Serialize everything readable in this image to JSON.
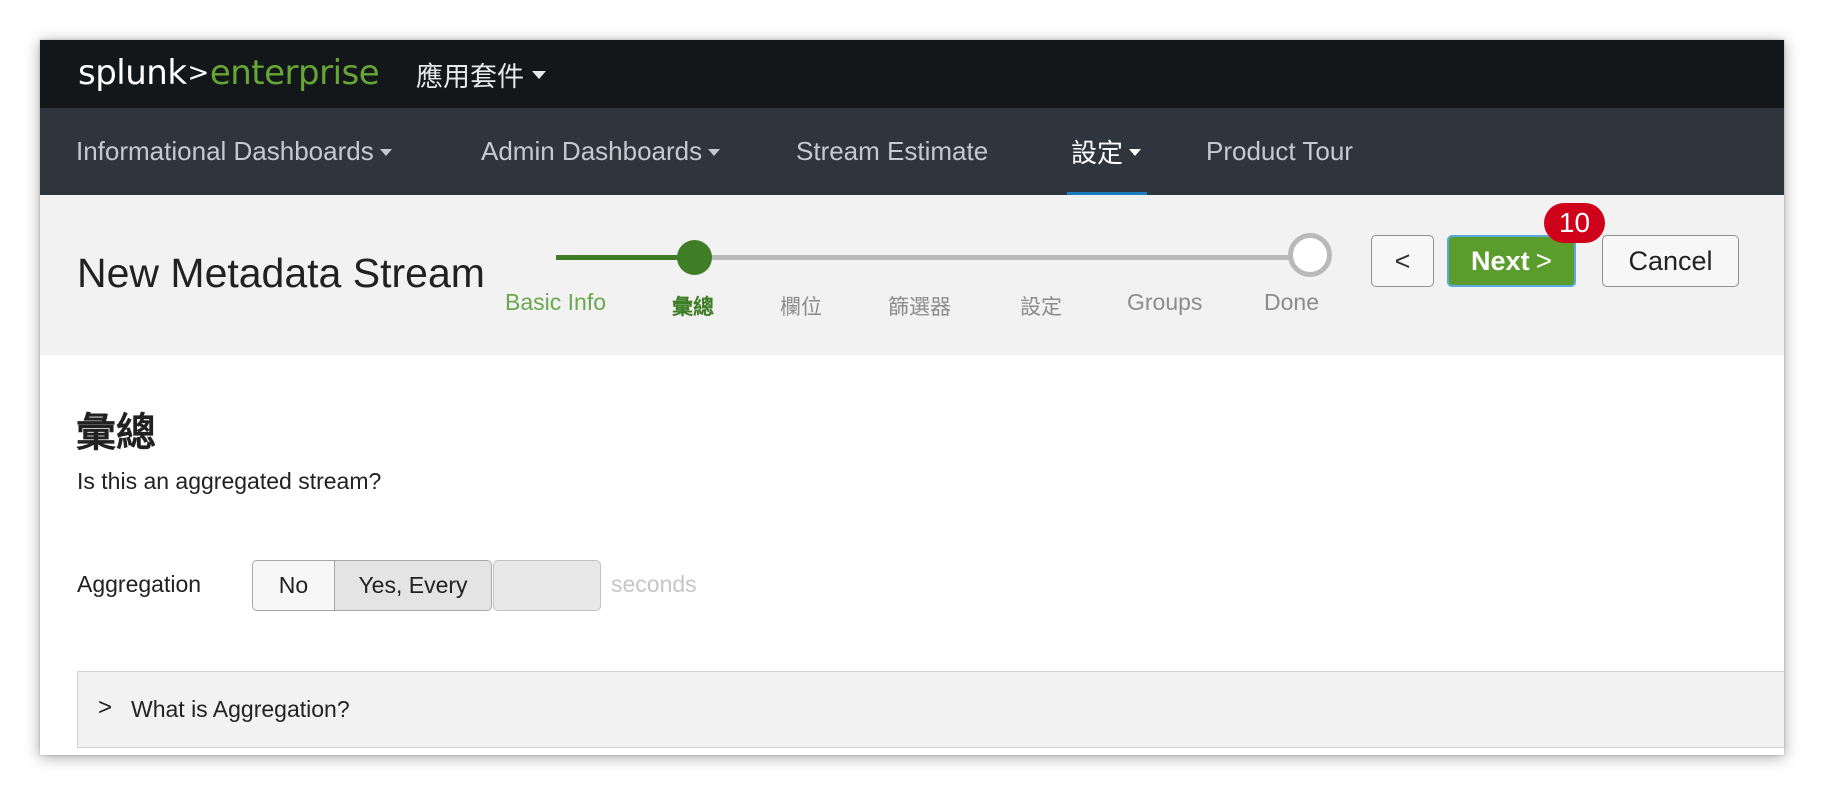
{
  "topbar": {
    "logo_splunk": "splunk",
    "logo_chevron": ">",
    "logo_enterprise": "enterprise",
    "apps_label": "應用套件"
  },
  "nav": {
    "items": [
      {
        "label": "Informational Dashboards",
        "dropdown": true
      },
      {
        "label": "Admin Dashboards",
        "dropdown": true
      },
      {
        "label": "Stream Estimate",
        "dropdown": false
      },
      {
        "label": "設定",
        "dropdown": true,
        "active": true
      },
      {
        "label": "Product Tour",
        "dropdown": false
      }
    ]
  },
  "header": {
    "title": "New Metadata Stream",
    "steps": [
      "Basic Info",
      "彙總",
      "欄位",
      "篩選器",
      "設定",
      "Groups",
      "Done"
    ],
    "current_step": 1,
    "back_label": "<",
    "next_label": "Next",
    "next_chevron": ">",
    "cancel_label": "Cancel",
    "badge": "10"
  },
  "content": {
    "section_title": "彙總",
    "section_subtitle": "Is this an aggregated stream?",
    "aggregation_label": "Aggregation",
    "option_no": "No",
    "option_yes": "Yes, Every",
    "seconds_value": "",
    "seconds_unit": "seconds",
    "accordion_arrow": ">",
    "accordion_label": "What is Aggregation?"
  },
  "colors": {
    "topbar": "#14171a",
    "appnav": "#2e353c",
    "accent_green": "#5b9d2c",
    "step_green": "#3f7e27",
    "badge_red": "#d0021b",
    "active_underline": "#1a7dbe"
  }
}
